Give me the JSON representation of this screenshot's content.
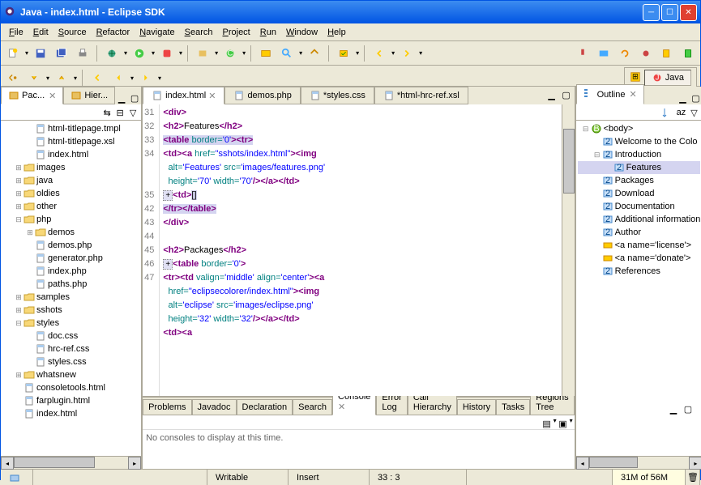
{
  "window": {
    "title": "Java - index.html - Eclipse SDK"
  },
  "menu": [
    "File",
    "Edit",
    "Source",
    "Refactor",
    "Navigate",
    "Search",
    "Project",
    "Run",
    "Window",
    "Help"
  ],
  "perspective": "Java",
  "left": {
    "tabs": [
      {
        "label": "Pac...",
        "active": true
      },
      {
        "label": "Hier...",
        "active": false
      }
    ],
    "tree": [
      {
        "label": "html-titlepage.tmpl",
        "type": "file",
        "indent": 2
      },
      {
        "label": "html-titlepage.xsl",
        "type": "file",
        "indent": 2
      },
      {
        "label": "index.html",
        "type": "file",
        "indent": 2
      },
      {
        "label": "images",
        "type": "folder",
        "indent": 1,
        "twisty": "+"
      },
      {
        "label": "java",
        "type": "folder",
        "indent": 1,
        "twisty": "+"
      },
      {
        "label": "oldies",
        "type": "folder",
        "indent": 1,
        "twisty": "+"
      },
      {
        "label": "other",
        "type": "folder",
        "indent": 1,
        "twisty": "+"
      },
      {
        "label": "php",
        "type": "folder",
        "indent": 1,
        "twisty": "-"
      },
      {
        "label": "demos",
        "type": "folder",
        "indent": 2,
        "twisty": "+"
      },
      {
        "label": "demos.php",
        "type": "file",
        "indent": 2
      },
      {
        "label": "generator.php",
        "type": "file",
        "indent": 2
      },
      {
        "label": "index.php",
        "type": "file",
        "indent": 2
      },
      {
        "label": "paths.php",
        "type": "file",
        "indent": 2
      },
      {
        "label": "samples",
        "type": "folder",
        "indent": 1,
        "twisty": "+"
      },
      {
        "label": "sshots",
        "type": "folder",
        "indent": 1,
        "twisty": "+"
      },
      {
        "label": "styles",
        "type": "folder",
        "indent": 1,
        "twisty": "-"
      },
      {
        "label": "doc.css",
        "type": "file",
        "indent": 2
      },
      {
        "label": "hrc-ref.css",
        "type": "file",
        "indent": 2
      },
      {
        "label": "styles.css",
        "type": "file",
        "indent": 2
      },
      {
        "label": "whatsnew",
        "type": "folder",
        "indent": 1,
        "twisty": "+"
      },
      {
        "label": "consoletools.html",
        "type": "file",
        "indent": 1
      },
      {
        "label": "farplugin.html",
        "type": "file",
        "indent": 1
      },
      {
        "label": "index.html",
        "type": "file",
        "indent": 1
      }
    ]
  },
  "editor": {
    "tabs": [
      {
        "label": "index.html",
        "active": true
      },
      {
        "label": "demos.php",
        "active": false
      },
      {
        "label": "*styles.css",
        "active": false
      },
      {
        "label": "*html-hrc-ref.xsl",
        "active": false
      }
    ],
    "lines": [
      {
        "n": "31",
        "html": "<span class='t'>&lt;div&gt;</span>"
      },
      {
        "n": "32",
        "html": "<span class='t'>&lt;h2&gt;</span>Features<span class='t'>&lt;/h2&gt;</span>"
      },
      {
        "n": "33",
        "html": "<span class='hl'><span class='t'>&lt;table</span> <span class='a'>border=</span><span class='v'>'0'</span><span class='t'>&gt;&lt;tr&gt;</span></span>"
      },
      {
        "n": "34",
        "html": "<span class='t'>&lt;td&gt;&lt;a</span> <span class='a'>href=</span><span class='v'>\"sshots/index.html\"</span><span class='t'>&gt;&lt;img</span>"
      },
      {
        "n": "",
        "html": "  <span class='a'>alt=</span><span class='v'>'Features'</span> <span class='a'>src=</span><span class='v'>'images/features.png'</span>"
      },
      {
        "n": "",
        "html": "  <span class='a'>height=</span><span class='v'>'70'</span> <span class='a'>width=</span><span class='v'>'70'</span><span class='t'>/&gt;&lt;/a&gt;&lt;/td&gt;</span>"
      },
      {
        "n": "35",
        "html": "<span class='ex'>+</span><span class='t'>&lt;td&gt;</span><span class='hl'>[]</span>"
      },
      {
        "n": "42",
        "html": "<span class='hl'><span class='t'>&lt;/tr&gt;&lt;/table&gt;</span></span>"
      },
      {
        "n": "43",
        "html": "<span class='t'>&lt;/div&gt;</span>"
      },
      {
        "n": "44",
        "html": ""
      },
      {
        "n": "45",
        "html": "<span class='t'>&lt;h2&gt;</span>Packages<span class='t'>&lt;/h2&gt;</span>"
      },
      {
        "n": "46",
        "html": "<span class='ex'>+</span><span class='t'>&lt;table</span> <span class='a'>border=</span><span class='v'>'0'</span><span class='t'>&gt;</span>"
      },
      {
        "n": "47",
        "html": "<span class='t'>&lt;tr&gt;&lt;td</span> <span class='a'>valign=</span><span class='v'>'middle'</span> <span class='a'>align=</span><span class='v'>'center'</span><span class='t'>&gt;&lt;a</span>"
      },
      {
        "n": "",
        "html": "  <span class='a'>href=</span><span class='v'>\"eclipsecolorer/index.html\"</span><span class='t'>&gt;&lt;img</span>"
      },
      {
        "n": "",
        "html": "  <span class='a'>alt=</span><span class='v'>'eclipse'</span> <span class='a'>src=</span><span class='v'>'images/eclipse.png'</span>"
      },
      {
        "n": "",
        "html": "  <span class='a'>height=</span><span class='v'>'32'</span> <span class='a'>width=</span><span class='v'>'32'</span><span class='t'>/&gt;&lt;/a&gt;&lt;/td&gt;</span>"
      },
      {
        "n": "",
        "html": "<span class='t'>&lt;td&gt;&lt;a</span>"
      }
    ]
  },
  "bottom": {
    "tabs": [
      "Problems",
      "Javadoc",
      "Declaration",
      "Search",
      "Console",
      "Error Log",
      "Call Hierarchy",
      "History",
      "Tasks",
      "HRC Regions Tree"
    ],
    "active": 4,
    "message": "No consoles to display at this time."
  },
  "outline": {
    "title": "Outline",
    "nodes": [
      {
        "label": "<body>",
        "indent": 0,
        "twisty": "-",
        "icon": "body"
      },
      {
        "label": "Welcome to the Colo",
        "indent": 1,
        "icon": "h"
      },
      {
        "label": "Introduction",
        "indent": 1,
        "twisty": "-",
        "icon": "h"
      },
      {
        "label": "Features",
        "indent": 2,
        "icon": "h",
        "sel": true
      },
      {
        "label": "Packages",
        "indent": 1,
        "icon": "h"
      },
      {
        "label": "Download",
        "indent": 1,
        "icon": "h"
      },
      {
        "label": "Documentation",
        "indent": 1,
        "icon": "h"
      },
      {
        "label": "Additional information",
        "indent": 1,
        "icon": "h"
      },
      {
        "label": "Author",
        "indent": 1,
        "icon": "h"
      },
      {
        "label": "<a name='license'>",
        "indent": 1,
        "icon": "a"
      },
      {
        "label": "<a name='donate'>",
        "indent": 1,
        "icon": "a"
      },
      {
        "label": "References",
        "indent": 1,
        "icon": "h"
      }
    ]
  },
  "status": {
    "writable": "Writable",
    "mode": "Insert",
    "pos": "33 : 3",
    "mem": "31M of 56M"
  }
}
